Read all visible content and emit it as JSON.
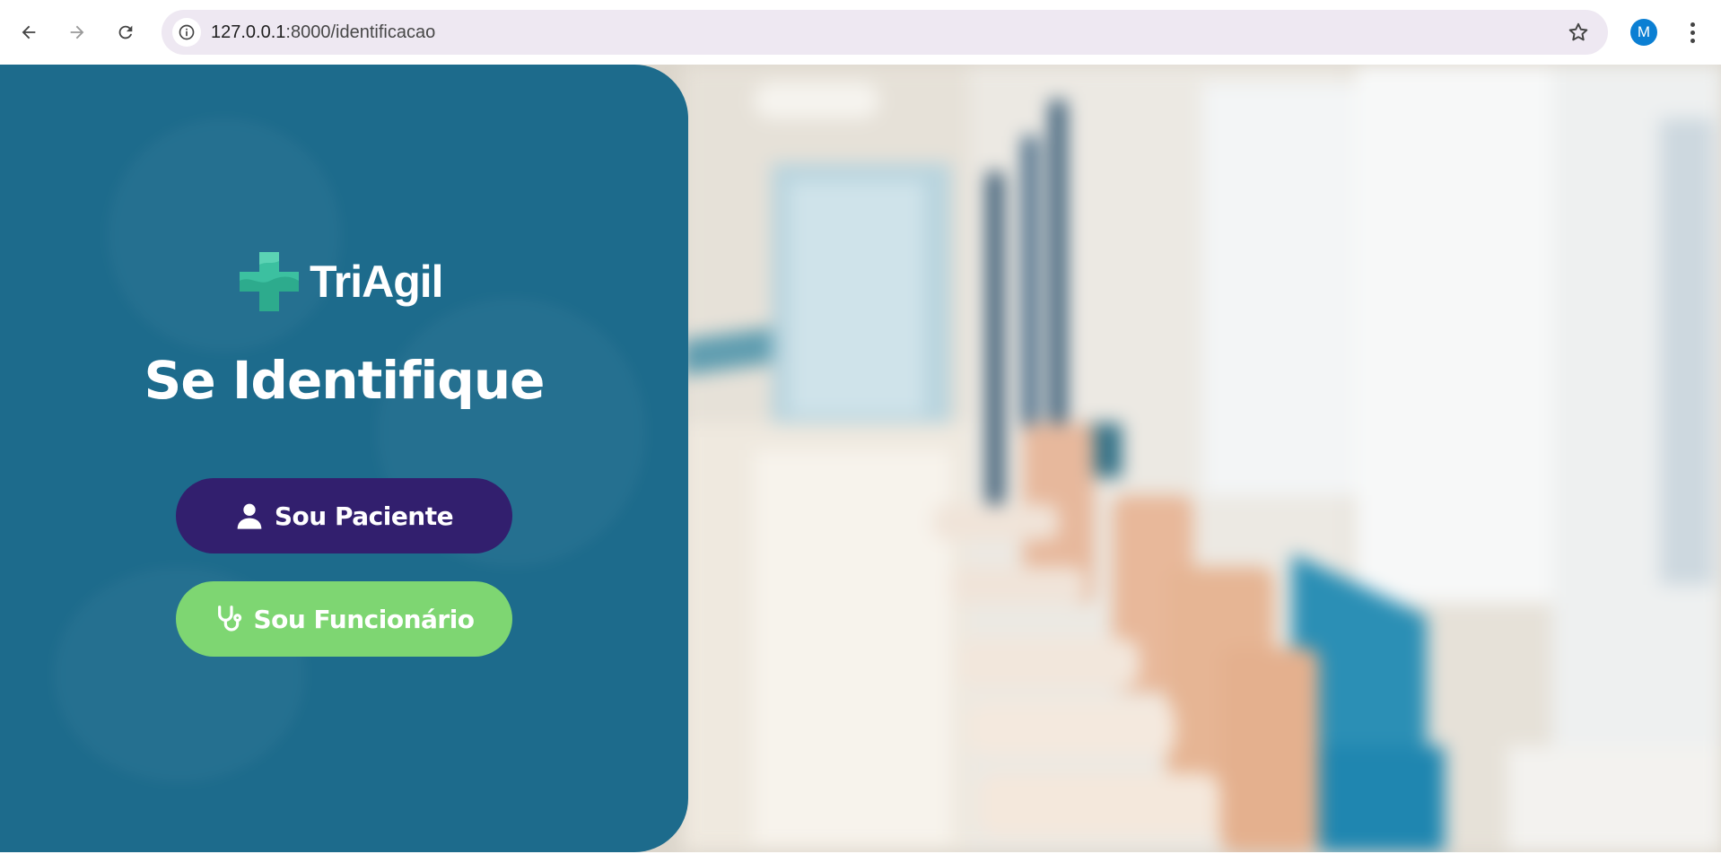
{
  "browser": {
    "url_host": "127.0.0.1",
    "url_path": ":8000/identificacao",
    "profile_initial": "M",
    "avatar_color": "#0b7fd3"
  },
  "page": {
    "brand_name": "TriAgil",
    "title": "Se Identifique",
    "buttons": {
      "paciente_label": "Sou Paciente",
      "funcionario_label": "Sou Funcionário"
    },
    "colors": {
      "panel": "#1d6b8c",
      "paciente_button": "#321f6e",
      "funcionario_button": "#7ed672",
      "logo_cross": "#3cc0a0"
    },
    "background_image": "blurred hospital corridor with waiting chairs"
  }
}
